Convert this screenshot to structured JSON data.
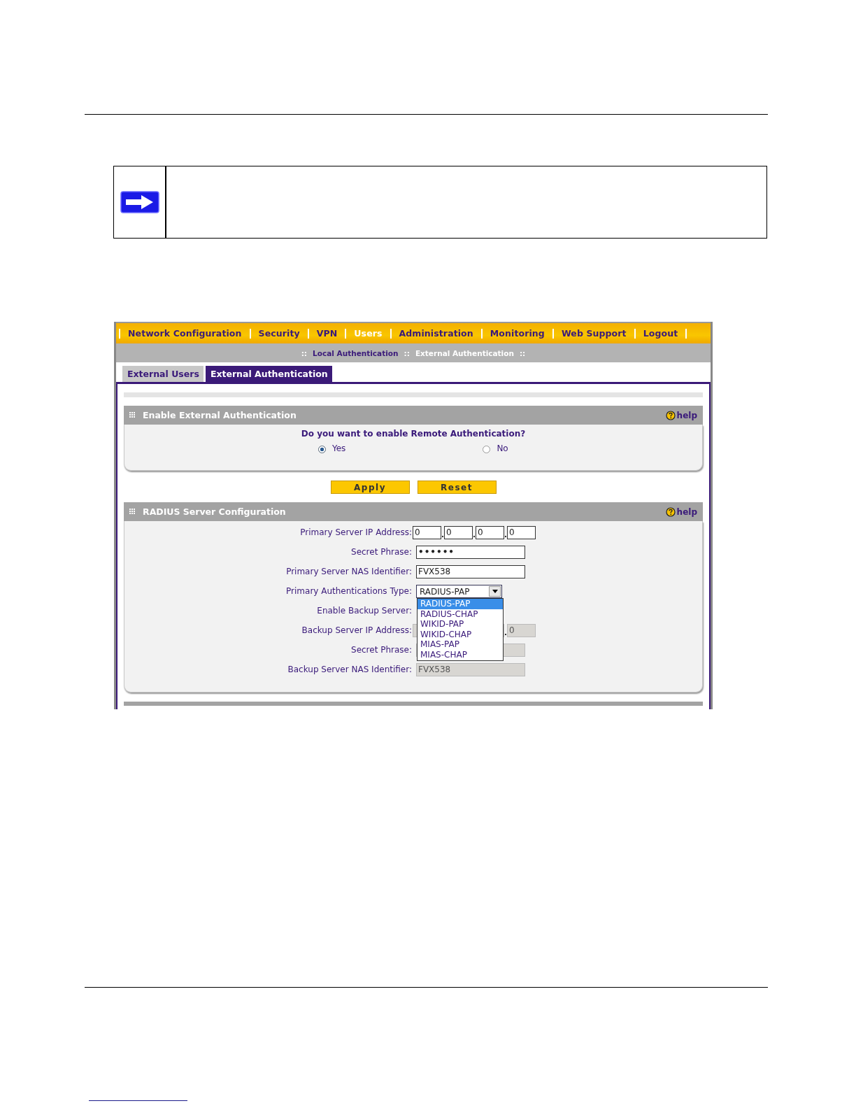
{
  "nav": [
    {
      "label": "Network Configuration",
      "selected": false
    },
    {
      "label": "Security",
      "selected": false
    },
    {
      "label": "VPN",
      "selected": false
    },
    {
      "label": "Users",
      "selected": true
    },
    {
      "label": "Administration",
      "selected": false
    },
    {
      "label": "Monitoring",
      "selected": false
    },
    {
      "label": "Web Support",
      "selected": false
    },
    {
      "label": "Logout",
      "selected": false
    }
  ],
  "subnav": {
    "separator": "::",
    "items": [
      {
        "label": "Local Authentication",
        "selected": false
      },
      {
        "label": "External Authentication",
        "selected": true
      }
    ]
  },
  "tabs": [
    {
      "label": "External Users",
      "selected": false
    },
    {
      "label": "External Authentication",
      "selected": true
    }
  ],
  "enable_section": {
    "title": "Enable External Authentication",
    "help": "help",
    "question": "Do you want to enable Remote Authentication?",
    "options": [
      {
        "label": "Yes",
        "selected": true
      },
      {
        "label": "No",
        "selected": false
      }
    ]
  },
  "buttons": [
    "Apply",
    "Reset"
  ],
  "radius_section": {
    "title": "RADIUS Server Configuration",
    "help": "help",
    "rows": [
      {
        "kind": "ip",
        "label": "Primary Server IP Address:",
        "disabled": false,
        "octets": [
          "0",
          "0",
          "0",
          "0"
        ]
      },
      {
        "kind": "password",
        "label": "Secret Phrase:",
        "disabled": false,
        "value": "••••••"
      },
      {
        "kind": "text",
        "label": "Primary Server NAS Identifier:",
        "disabled": false,
        "value": "FVX538"
      },
      {
        "kind": "select",
        "label": "Primary Authentications Type:",
        "value": "RADIUS-PAP",
        "expanded": true,
        "options": [
          {
            "label": "RADIUS-PAP",
            "selected": true
          },
          {
            "label": "RADIUS-CHAP",
            "selected": false
          },
          {
            "label": "WIKID-PAP",
            "selected": false
          },
          {
            "label": "WIKID-CHAP",
            "selected": false
          },
          {
            "label": "MIAS-PAP",
            "selected": false
          },
          {
            "label": "MIAS-CHAP",
            "selected": false
          }
        ]
      },
      {
        "kind": "checkbox",
        "label": "Enable Backup Server:"
      },
      {
        "kind": "ip",
        "label": "Backup Server IP Address:",
        "disabled": true,
        "octets": [
          "0"
        ]
      },
      {
        "kind": "password",
        "label": "Secret Phrase:",
        "disabled": true,
        "value": ""
      },
      {
        "kind": "text",
        "label": "Backup Server NAS Identifier:",
        "disabled": true,
        "value": "FVX538"
      }
    ]
  }
}
